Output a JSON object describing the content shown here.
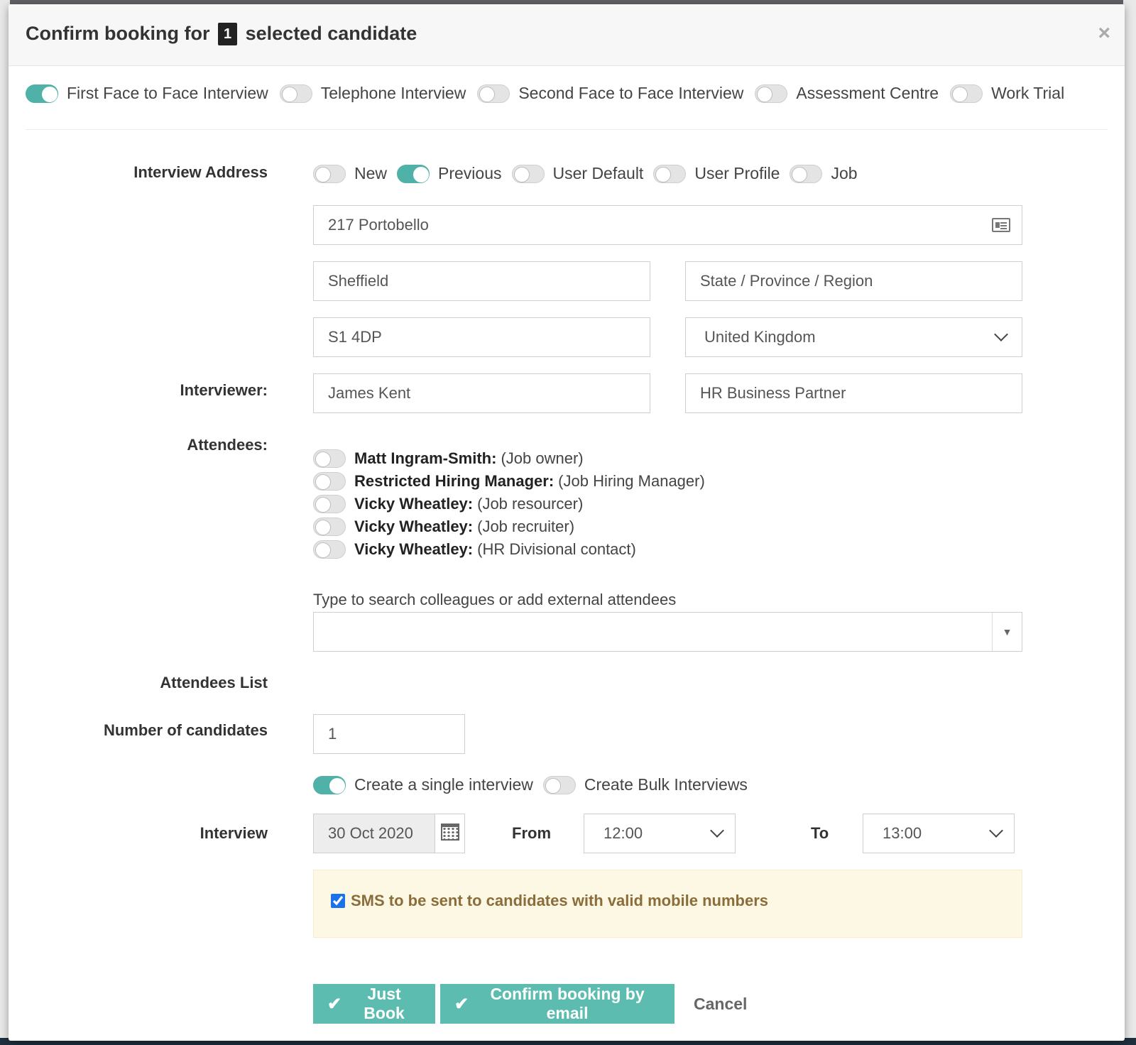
{
  "header": {
    "title_prefix": "Confirm booking for",
    "count": "1",
    "title_suffix": "selected candidate",
    "close": "×"
  },
  "interview_types": [
    {
      "label": "First Face to Face Interview",
      "on": true
    },
    {
      "label": "Telephone Interview",
      "on": false
    },
    {
      "label": "Second Face to Face Interview",
      "on": false
    },
    {
      "label": "Assessment Centre",
      "on": false
    },
    {
      "label": "Work Trial",
      "on": false
    }
  ],
  "address": {
    "label": "Interview Address",
    "sources": [
      {
        "label": "New",
        "on": false
      },
      {
        "label": "Previous",
        "on": true
      },
      {
        "label": "User Default",
        "on": false
      },
      {
        "label": "User Profile",
        "on": false
      },
      {
        "label": "Job",
        "on": false
      }
    ],
    "line1": "217 Portobello",
    "city": "Sheffield",
    "region_placeholder": "State / Province / Region",
    "postcode": "S1 4DP",
    "country": "United Kingdom"
  },
  "interviewer": {
    "label": "Interviewer:",
    "name": "James Kent",
    "role": "HR Business Partner"
  },
  "attendees": {
    "label": "Attendees:",
    "items": [
      {
        "name": "Matt Ingram-Smith:",
        "role": "(Job owner)",
        "on": false
      },
      {
        "name": "Restricted Hiring Manager:",
        "role": "(Job Hiring Manager)",
        "on": false
      },
      {
        "name": "Vicky Wheatley:",
        "role": "(Job resourcer)",
        "on": false
      },
      {
        "name": "Vicky Wheatley:",
        "role": "(Job recruiter)",
        "on": false
      },
      {
        "name": "Vicky Wheatley:",
        "role": "(HR Divisional contact)",
        "on": false
      }
    ],
    "search_label": "Type to search colleagues or add external attendees",
    "search_value": "",
    "list_label": "Attendees List"
  },
  "candidates": {
    "label": "Number of candidates",
    "value": "1",
    "modes": [
      {
        "label": "Create a single interview",
        "on": true
      },
      {
        "label": "Create Bulk Interviews",
        "on": false
      }
    ]
  },
  "schedule": {
    "label": "Interview",
    "date": "30 Oct 2020",
    "from_label": "From",
    "from": "12:00",
    "to_label": "To",
    "to": "13:00"
  },
  "sms": {
    "label": "SMS to be sent to candidates with valid mobile numbers",
    "checked": true
  },
  "actions": {
    "just_book": "Just Book",
    "confirm_email": "Confirm booking by email",
    "cancel": "Cancel"
  },
  "colors": {
    "accent": "#5cbcb0",
    "toggle_on": "#4fb1a7",
    "warning_bg": "#fcf8e3",
    "warning_text": "#8a6d3b"
  },
  "icons": {
    "close": "close-icon",
    "check": "check-icon",
    "calendar": "calendar-icon",
    "address_card": "address-card-icon",
    "chevron": "chevron-down-icon"
  }
}
